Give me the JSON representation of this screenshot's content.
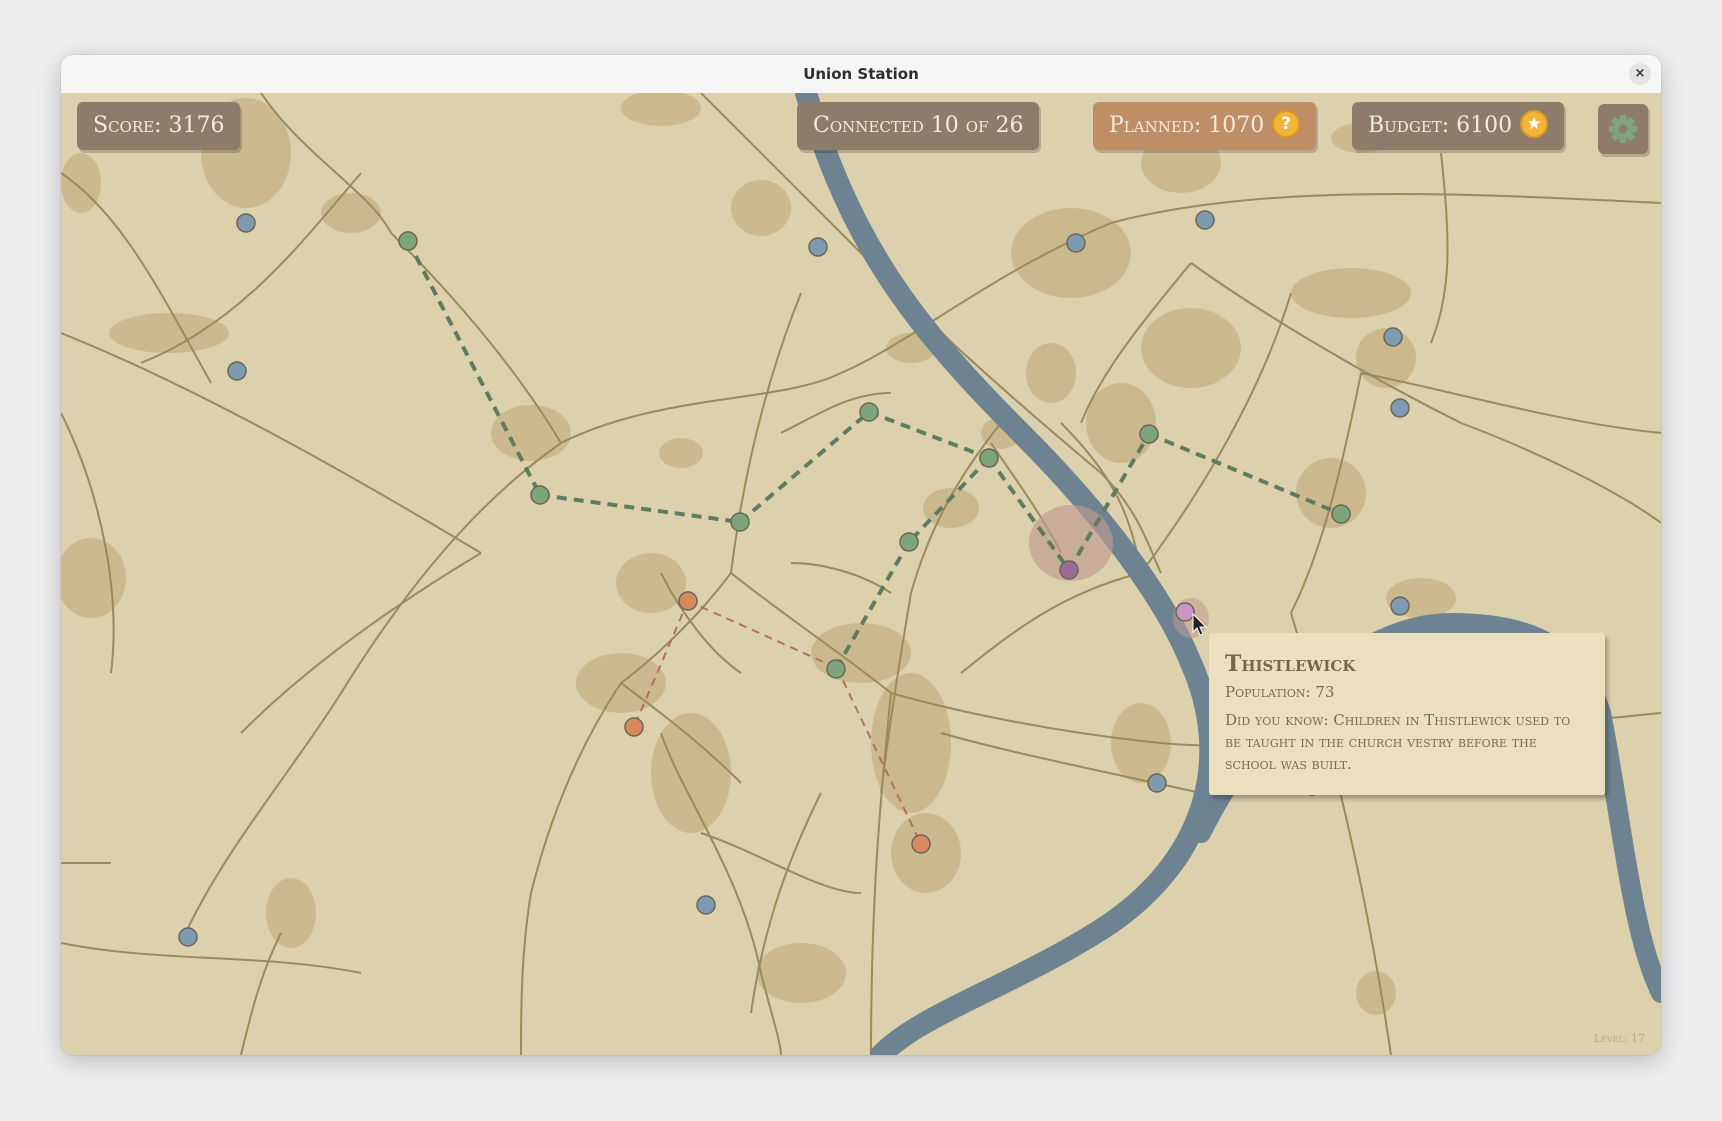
{
  "window": {
    "title": "Union Station",
    "close_label": "×"
  },
  "hud": {
    "score_label": "Score: 3176",
    "connected_label": "Connected 10 of 26",
    "planned_label": "Planned: 1070",
    "planned_icon": "question-coin-icon",
    "planned_icon_glyph": "?",
    "budget_label": "Budget: 6100",
    "budget_icon": "star-coin-icon",
    "budget_icon_glyph": "★",
    "settings_icon": "gear-icon"
  },
  "tooltip": {
    "town_name": "Thistlewick",
    "population": "Population: 73",
    "fact": "Did you know: Children in Thistlewick used to be taught in the church vestry before the school was built."
  },
  "level_label": "Level: 17",
  "colors": {
    "map_bg": "#dcd0ad",
    "river": "#6e8391",
    "road": "#9a8a5c",
    "town_connected": "#7da47b",
    "town_unconnected": "#7d9ab0",
    "town_planned": "#d88a5e",
    "town_selected": "#9a6a98",
    "hud_panel": "#8f7b69",
    "hud_planned": "#c08e66",
    "rail_built": "#5e7d60",
    "rail_planned": "#b0725a"
  }
}
